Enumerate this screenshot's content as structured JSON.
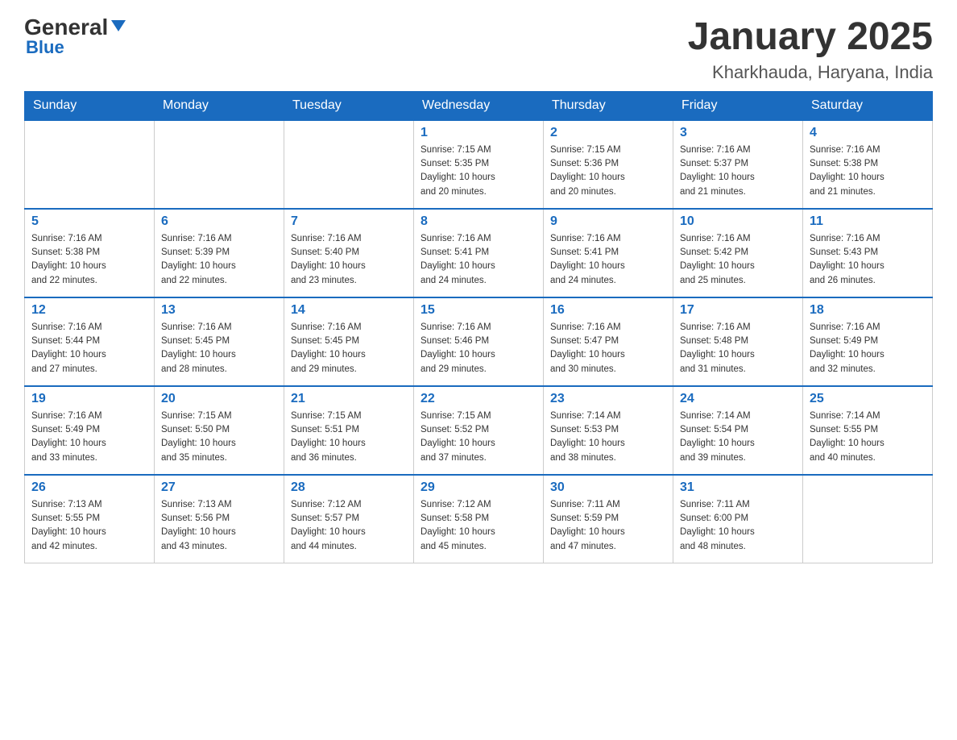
{
  "header": {
    "logo_main": "General",
    "logo_sub": "Blue",
    "title": "January 2025",
    "subtitle": "Kharkhauda, Haryana, India"
  },
  "days_of_week": [
    "Sunday",
    "Monday",
    "Tuesday",
    "Wednesday",
    "Thursday",
    "Friday",
    "Saturday"
  ],
  "weeks": [
    [
      {
        "day": "",
        "info": ""
      },
      {
        "day": "",
        "info": ""
      },
      {
        "day": "",
        "info": ""
      },
      {
        "day": "1",
        "info": "Sunrise: 7:15 AM\nSunset: 5:35 PM\nDaylight: 10 hours\nand 20 minutes."
      },
      {
        "day": "2",
        "info": "Sunrise: 7:15 AM\nSunset: 5:36 PM\nDaylight: 10 hours\nand 20 minutes."
      },
      {
        "day": "3",
        "info": "Sunrise: 7:16 AM\nSunset: 5:37 PM\nDaylight: 10 hours\nand 21 minutes."
      },
      {
        "day": "4",
        "info": "Sunrise: 7:16 AM\nSunset: 5:38 PM\nDaylight: 10 hours\nand 21 minutes."
      }
    ],
    [
      {
        "day": "5",
        "info": "Sunrise: 7:16 AM\nSunset: 5:38 PM\nDaylight: 10 hours\nand 22 minutes."
      },
      {
        "day": "6",
        "info": "Sunrise: 7:16 AM\nSunset: 5:39 PM\nDaylight: 10 hours\nand 22 minutes."
      },
      {
        "day": "7",
        "info": "Sunrise: 7:16 AM\nSunset: 5:40 PM\nDaylight: 10 hours\nand 23 minutes."
      },
      {
        "day": "8",
        "info": "Sunrise: 7:16 AM\nSunset: 5:41 PM\nDaylight: 10 hours\nand 24 minutes."
      },
      {
        "day": "9",
        "info": "Sunrise: 7:16 AM\nSunset: 5:41 PM\nDaylight: 10 hours\nand 24 minutes."
      },
      {
        "day": "10",
        "info": "Sunrise: 7:16 AM\nSunset: 5:42 PM\nDaylight: 10 hours\nand 25 minutes."
      },
      {
        "day": "11",
        "info": "Sunrise: 7:16 AM\nSunset: 5:43 PM\nDaylight: 10 hours\nand 26 minutes."
      }
    ],
    [
      {
        "day": "12",
        "info": "Sunrise: 7:16 AM\nSunset: 5:44 PM\nDaylight: 10 hours\nand 27 minutes."
      },
      {
        "day": "13",
        "info": "Sunrise: 7:16 AM\nSunset: 5:45 PM\nDaylight: 10 hours\nand 28 minutes."
      },
      {
        "day": "14",
        "info": "Sunrise: 7:16 AM\nSunset: 5:45 PM\nDaylight: 10 hours\nand 29 minutes."
      },
      {
        "day": "15",
        "info": "Sunrise: 7:16 AM\nSunset: 5:46 PM\nDaylight: 10 hours\nand 29 minutes."
      },
      {
        "day": "16",
        "info": "Sunrise: 7:16 AM\nSunset: 5:47 PM\nDaylight: 10 hours\nand 30 minutes."
      },
      {
        "day": "17",
        "info": "Sunrise: 7:16 AM\nSunset: 5:48 PM\nDaylight: 10 hours\nand 31 minutes."
      },
      {
        "day": "18",
        "info": "Sunrise: 7:16 AM\nSunset: 5:49 PM\nDaylight: 10 hours\nand 32 minutes."
      }
    ],
    [
      {
        "day": "19",
        "info": "Sunrise: 7:16 AM\nSunset: 5:49 PM\nDaylight: 10 hours\nand 33 minutes."
      },
      {
        "day": "20",
        "info": "Sunrise: 7:15 AM\nSunset: 5:50 PM\nDaylight: 10 hours\nand 35 minutes."
      },
      {
        "day": "21",
        "info": "Sunrise: 7:15 AM\nSunset: 5:51 PM\nDaylight: 10 hours\nand 36 minutes."
      },
      {
        "day": "22",
        "info": "Sunrise: 7:15 AM\nSunset: 5:52 PM\nDaylight: 10 hours\nand 37 minutes."
      },
      {
        "day": "23",
        "info": "Sunrise: 7:14 AM\nSunset: 5:53 PM\nDaylight: 10 hours\nand 38 minutes."
      },
      {
        "day": "24",
        "info": "Sunrise: 7:14 AM\nSunset: 5:54 PM\nDaylight: 10 hours\nand 39 minutes."
      },
      {
        "day": "25",
        "info": "Sunrise: 7:14 AM\nSunset: 5:55 PM\nDaylight: 10 hours\nand 40 minutes."
      }
    ],
    [
      {
        "day": "26",
        "info": "Sunrise: 7:13 AM\nSunset: 5:55 PM\nDaylight: 10 hours\nand 42 minutes."
      },
      {
        "day": "27",
        "info": "Sunrise: 7:13 AM\nSunset: 5:56 PM\nDaylight: 10 hours\nand 43 minutes."
      },
      {
        "day": "28",
        "info": "Sunrise: 7:12 AM\nSunset: 5:57 PM\nDaylight: 10 hours\nand 44 minutes."
      },
      {
        "day": "29",
        "info": "Sunrise: 7:12 AM\nSunset: 5:58 PM\nDaylight: 10 hours\nand 45 minutes."
      },
      {
        "day": "30",
        "info": "Sunrise: 7:11 AM\nSunset: 5:59 PM\nDaylight: 10 hours\nand 47 minutes."
      },
      {
        "day": "31",
        "info": "Sunrise: 7:11 AM\nSunset: 6:00 PM\nDaylight: 10 hours\nand 48 minutes."
      },
      {
        "day": "",
        "info": ""
      }
    ]
  ]
}
